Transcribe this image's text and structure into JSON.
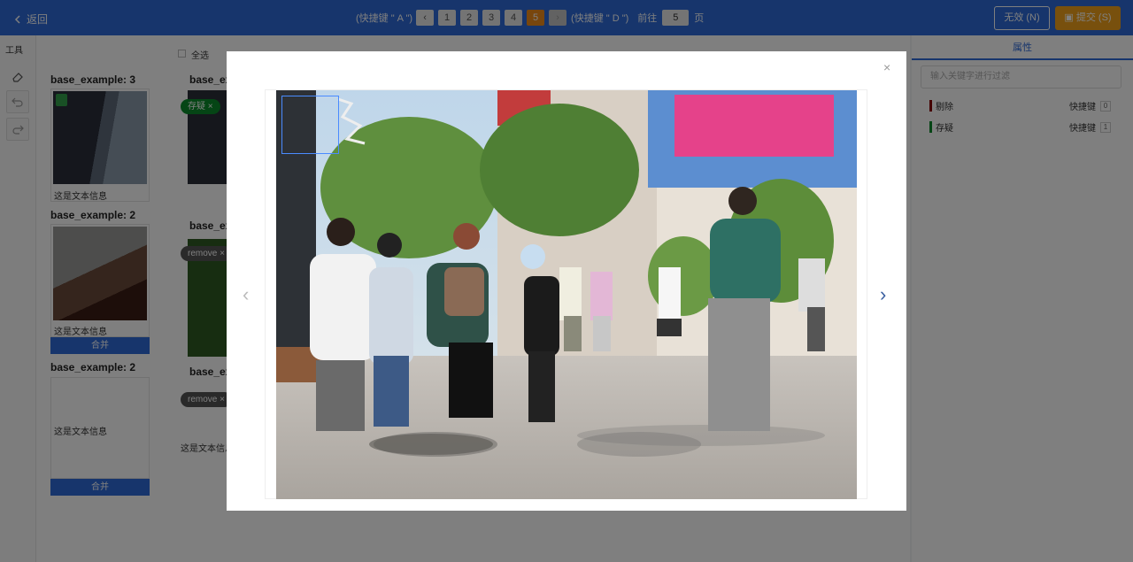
{
  "topbar": {
    "back_label": "返回",
    "prev_hint": "(快捷键 \" A \")",
    "next_hint": "(快捷键 \" D \")",
    "pages": [
      "1",
      "2",
      "3",
      "4",
      "5"
    ],
    "active_page": "5",
    "goto_label": "前往",
    "goto_value": "5",
    "page_unit": "页",
    "invalid_label": "无效 (N)",
    "submit_label": "提交 (S)"
  },
  "toolbar": {
    "title": "工具"
  },
  "groups": [
    {
      "title": "base_example: 3",
      "text": "这是文本信息"
    },
    {
      "title": "base_example: 2",
      "text": "这是文本信息",
      "merge_label": "合并"
    },
    {
      "title": "base_example: 2",
      "text": "这是文本信息",
      "merge_label": "合并"
    }
  ],
  "middle": {
    "select_all": "全选",
    "group_titles": [
      "base_ex",
      "base_ex",
      "base_ex"
    ],
    "tags": [
      "存疑",
      "remove",
      "remove"
    ],
    "text": "这是文本信息"
  },
  "right_panel": {
    "tab_label": "属性",
    "search_placeholder": "输入关键字进行过滤",
    "attributes": [
      {
        "name": "剔除",
        "shortcut": "快捷键",
        "key": "0",
        "color": "#8b0000"
      },
      {
        "name": "存疑",
        "shortcut": "快捷键",
        "key": "1",
        "color": "#0a8a2a"
      }
    ]
  },
  "modal": {
    "close": "×"
  },
  "colors": {
    "primary": "#2f6bd8",
    "accent": "#f08c1a"
  }
}
